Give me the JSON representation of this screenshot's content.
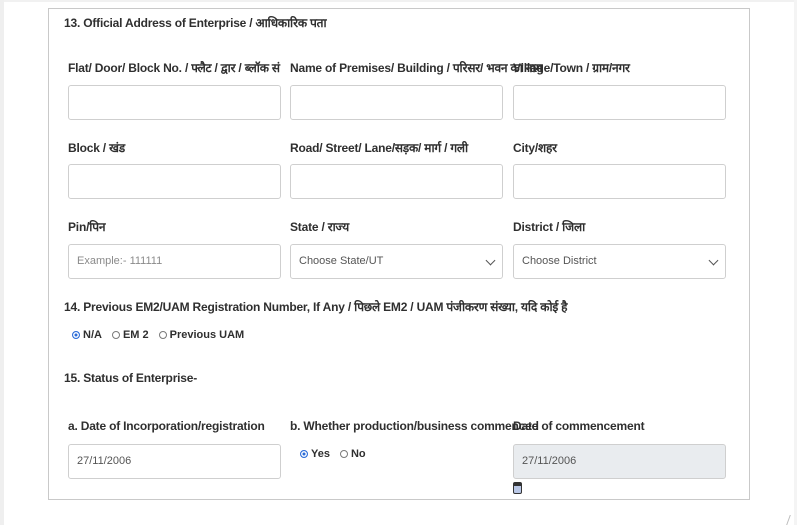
{
  "section13": {
    "heading": "13. Official Address of Enterprise / आधिकारिक पता",
    "fields": {
      "flat": {
        "label": "Flat/ Door/ Block No. / फ्लैट / द्वार / ब्लॉक सं",
        "value": ""
      },
      "premises": {
        "label": "Name of Premises/ Building / परिसर/ भवन का नाम",
        "value": ""
      },
      "village": {
        "label": "Village/Town / ग्राम/नगर",
        "value": ""
      },
      "block": {
        "label": "Block / खंड",
        "value": ""
      },
      "road": {
        "label": "Road/ Street/ Lane/सड़क/ मार्ग / गली",
        "value": ""
      },
      "city": {
        "label": "City/शहर",
        "value": ""
      },
      "pin": {
        "label": "Pin/पिन",
        "placeholder": "Example:- 111111"
      },
      "state": {
        "label": "State / राज्य",
        "selected": "Choose State/UT"
      },
      "district": {
        "label": "District / जिला",
        "selected": "Choose District"
      }
    }
  },
  "section14": {
    "heading": "14. Previous EM2/UAM Registration Number, If Any / पिछले EM2 / UAM पंजीकरण संख्या, यदि कोई है",
    "options": [
      {
        "label": "N/A",
        "selected": true
      },
      {
        "label": "EM 2",
        "selected": false
      },
      {
        "label": "Previous UAM",
        "selected": false
      }
    ]
  },
  "section15": {
    "heading": "15. Status of Enterprise-",
    "incorporation": {
      "label": "a. Date of Incorporation/registration",
      "value": "27/11/2006"
    },
    "production": {
      "label": "b. Whether production/business commenced",
      "options": [
        {
          "label": "Yes",
          "selected": true
        },
        {
          "label": "No",
          "selected": false
        }
      ]
    },
    "commencement": {
      "label": "Date of commencement",
      "value": "27/11/2006",
      "icon": "calendar-icon"
    }
  }
}
